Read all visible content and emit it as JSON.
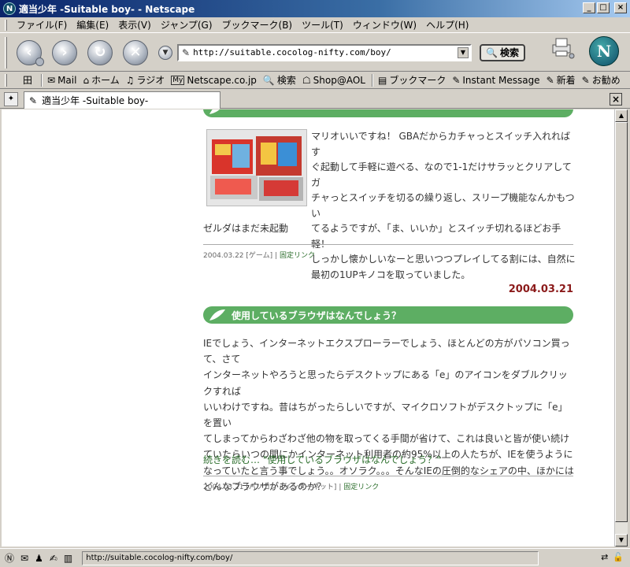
{
  "window": {
    "title": "適当少年 -Suitable boy- - Netscape",
    "app_icon": "N",
    "buttons": [
      "_",
      "□",
      "×"
    ]
  },
  "menubar": [
    "ファイル(F)",
    "編集(E)",
    "表示(V)",
    "ジャンプ(G)",
    "ブックマーク(B)",
    "ツール(T)",
    "ウィンドウ(W)",
    "ヘルプ(H)"
  ],
  "navbar": {
    "url": "http://suitable.cocolog-nifty.com/boy/",
    "search_label": "検索",
    "logo": "N"
  },
  "personal_toolbar": [
    {
      "icon": "home-tab-icon",
      "glyph": "田",
      "label": ""
    },
    {
      "icon": "mail-icon",
      "glyph": "✉",
      "label": "Mail"
    },
    {
      "icon": "home-icon",
      "glyph": "⌂",
      "label": "ホーム"
    },
    {
      "icon": "radio-icon",
      "glyph": "♫",
      "label": "ラジオ"
    },
    {
      "icon": "my-icon",
      "glyph": "My",
      "label": "Netscape.co.jp"
    },
    {
      "icon": "search-icon",
      "glyph": "🔍",
      "label": "検索"
    },
    {
      "icon": "aol-icon",
      "glyph": "☖",
      "label": "Shop@AOL"
    },
    {
      "icon": "bookmark-icon",
      "glyph": "▤",
      "label": "ブックマーク"
    },
    {
      "icon": "link-icon",
      "glyph": "✎",
      "label": "Instant Message"
    },
    {
      "icon": "link-icon",
      "glyph": "✎",
      "label": "新着"
    },
    {
      "icon": "link-icon",
      "glyph": "✎",
      "label": "お勧め"
    }
  ],
  "tab": {
    "title": "適当少年 -Suitable boy-",
    "close": "×"
  },
  "post1": {
    "body_lines": [
      "マリオいいですね！ GBAだからカチャっとスイッチ入れればす",
      "ぐ起動して手軽に遊べる、なので1-1だけサラッとクリアしてガ",
      "チャっとスイッチを切るの繰り返し、スリープ機能なんかもつい",
      "てるようですが、「ま、いいか」とスイッチ切れるほどお手軽！",
      "しっかし懐かしいなーと思いつつプレイしてる割には、自然に",
      "最初の1UPキノコを取っていました。"
    ],
    "extra": "ゼルダはまだ未起動",
    "meta_date": "2004.03.22",
    "meta_category": "[ゲーム]",
    "meta_sep": "|",
    "meta_link": "固定リンク"
  },
  "post2": {
    "date": "2004.03.21",
    "title": "使用しているブラウザはなんでしょう？",
    "body_lines": [
      "IEでしょう、インターネットエクスプローラーでしょう、ほとんどの方がパソコン買って、さて",
      "インターネットやろうと思ったらデスクトップにある「e」のアイコンをダブルクリックすれば",
      "いいわけですね。昔はちがったらしいですが、マイクロソフトがデスクトップに「e」を置い",
      "てしまってからわざわざ他の物を取ってくる手間が省けて、これは良いと皆が使い続け",
      "ていたらいつの間にかインターネット利用者の約95%以上の人たちが、IEを使うように",
      "なっていたと言う事でしょう。。オソラク。。。そんなIEの圧倒的なシェアの中、ほかには",
      "どんなブラウザがあるのか？"
    ],
    "read_more": "続きを読む… \"使用しているブラウザはなんでしょう？\"",
    "meta_date": "2004.03.21",
    "meta_category": "[パソコン・インターネット]",
    "meta_sep": "|",
    "meta_link": "固定リンク"
  },
  "statusbar": {
    "url": "http://suitable.cocolog-nifty.com/boy/"
  },
  "colors": {
    "title_bar": "#0a246a",
    "post_header": "#5dae63",
    "date": "#8b1a1a",
    "link": "#2c6e2c"
  }
}
